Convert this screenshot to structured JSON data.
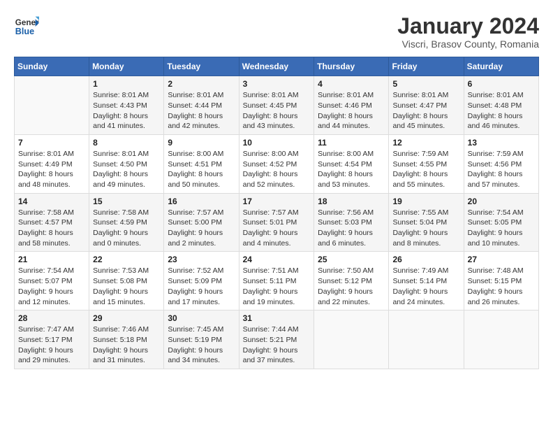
{
  "logo": {
    "line1": "General",
    "line2": "Blue"
  },
  "title": "January 2024",
  "subtitle": "Viscri, Brasov County, Romania",
  "days_of_week": [
    "Sunday",
    "Monday",
    "Tuesday",
    "Wednesday",
    "Thursday",
    "Friday",
    "Saturday"
  ],
  "weeks": [
    [
      {
        "day": "",
        "info": ""
      },
      {
        "day": "1",
        "info": "Sunrise: 8:01 AM\nSunset: 4:43 PM\nDaylight: 8 hours\nand 41 minutes."
      },
      {
        "day": "2",
        "info": "Sunrise: 8:01 AM\nSunset: 4:44 PM\nDaylight: 8 hours\nand 42 minutes."
      },
      {
        "day": "3",
        "info": "Sunrise: 8:01 AM\nSunset: 4:45 PM\nDaylight: 8 hours\nand 43 minutes."
      },
      {
        "day": "4",
        "info": "Sunrise: 8:01 AM\nSunset: 4:46 PM\nDaylight: 8 hours\nand 44 minutes."
      },
      {
        "day": "5",
        "info": "Sunrise: 8:01 AM\nSunset: 4:47 PM\nDaylight: 8 hours\nand 45 minutes."
      },
      {
        "day": "6",
        "info": "Sunrise: 8:01 AM\nSunset: 4:48 PM\nDaylight: 8 hours\nand 46 minutes."
      }
    ],
    [
      {
        "day": "7",
        "info": "Sunrise: 8:01 AM\nSunset: 4:49 PM\nDaylight: 8 hours\nand 48 minutes."
      },
      {
        "day": "8",
        "info": "Sunrise: 8:01 AM\nSunset: 4:50 PM\nDaylight: 8 hours\nand 49 minutes."
      },
      {
        "day": "9",
        "info": "Sunrise: 8:00 AM\nSunset: 4:51 PM\nDaylight: 8 hours\nand 50 minutes."
      },
      {
        "day": "10",
        "info": "Sunrise: 8:00 AM\nSunset: 4:52 PM\nDaylight: 8 hours\nand 52 minutes."
      },
      {
        "day": "11",
        "info": "Sunrise: 8:00 AM\nSunset: 4:54 PM\nDaylight: 8 hours\nand 53 minutes."
      },
      {
        "day": "12",
        "info": "Sunrise: 7:59 AM\nSunset: 4:55 PM\nDaylight: 8 hours\nand 55 minutes."
      },
      {
        "day": "13",
        "info": "Sunrise: 7:59 AM\nSunset: 4:56 PM\nDaylight: 8 hours\nand 57 minutes."
      }
    ],
    [
      {
        "day": "14",
        "info": "Sunrise: 7:58 AM\nSunset: 4:57 PM\nDaylight: 8 hours\nand 58 minutes."
      },
      {
        "day": "15",
        "info": "Sunrise: 7:58 AM\nSunset: 4:59 PM\nDaylight: 9 hours\nand 0 minutes."
      },
      {
        "day": "16",
        "info": "Sunrise: 7:57 AM\nSunset: 5:00 PM\nDaylight: 9 hours\nand 2 minutes."
      },
      {
        "day": "17",
        "info": "Sunrise: 7:57 AM\nSunset: 5:01 PM\nDaylight: 9 hours\nand 4 minutes."
      },
      {
        "day": "18",
        "info": "Sunrise: 7:56 AM\nSunset: 5:03 PM\nDaylight: 9 hours\nand 6 minutes."
      },
      {
        "day": "19",
        "info": "Sunrise: 7:55 AM\nSunset: 5:04 PM\nDaylight: 9 hours\nand 8 minutes."
      },
      {
        "day": "20",
        "info": "Sunrise: 7:54 AM\nSunset: 5:05 PM\nDaylight: 9 hours\nand 10 minutes."
      }
    ],
    [
      {
        "day": "21",
        "info": "Sunrise: 7:54 AM\nSunset: 5:07 PM\nDaylight: 9 hours\nand 12 minutes."
      },
      {
        "day": "22",
        "info": "Sunrise: 7:53 AM\nSunset: 5:08 PM\nDaylight: 9 hours\nand 15 minutes."
      },
      {
        "day": "23",
        "info": "Sunrise: 7:52 AM\nSunset: 5:09 PM\nDaylight: 9 hours\nand 17 minutes."
      },
      {
        "day": "24",
        "info": "Sunrise: 7:51 AM\nSunset: 5:11 PM\nDaylight: 9 hours\nand 19 minutes."
      },
      {
        "day": "25",
        "info": "Sunrise: 7:50 AM\nSunset: 5:12 PM\nDaylight: 9 hours\nand 22 minutes."
      },
      {
        "day": "26",
        "info": "Sunrise: 7:49 AM\nSunset: 5:14 PM\nDaylight: 9 hours\nand 24 minutes."
      },
      {
        "day": "27",
        "info": "Sunrise: 7:48 AM\nSunset: 5:15 PM\nDaylight: 9 hours\nand 26 minutes."
      }
    ],
    [
      {
        "day": "28",
        "info": "Sunrise: 7:47 AM\nSunset: 5:17 PM\nDaylight: 9 hours\nand 29 minutes."
      },
      {
        "day": "29",
        "info": "Sunrise: 7:46 AM\nSunset: 5:18 PM\nDaylight: 9 hours\nand 31 minutes."
      },
      {
        "day": "30",
        "info": "Sunrise: 7:45 AM\nSunset: 5:19 PM\nDaylight: 9 hours\nand 34 minutes."
      },
      {
        "day": "31",
        "info": "Sunrise: 7:44 AM\nSunset: 5:21 PM\nDaylight: 9 hours\nand 37 minutes."
      },
      {
        "day": "",
        "info": ""
      },
      {
        "day": "",
        "info": ""
      },
      {
        "day": "",
        "info": ""
      }
    ]
  ]
}
